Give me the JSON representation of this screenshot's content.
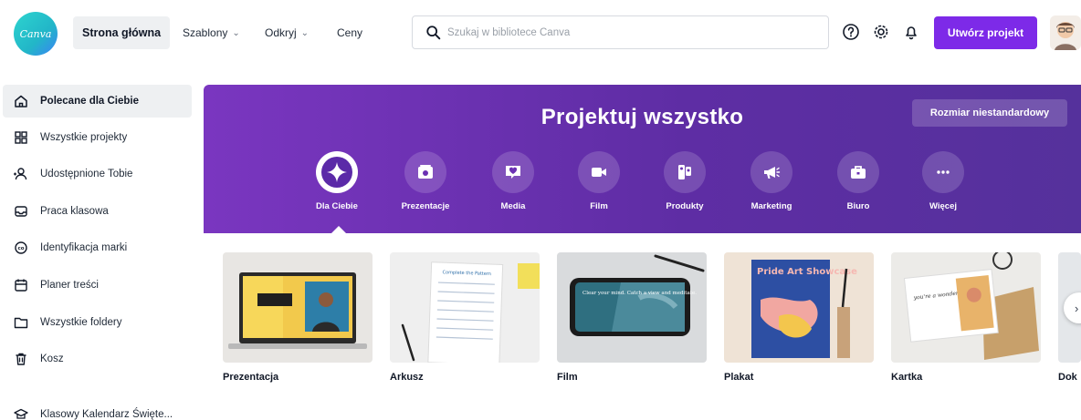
{
  "header": {
    "logo_text": "Canva",
    "nav": {
      "home": "Strona główna",
      "templates": "Szablony",
      "discover": "Odkryj",
      "prices": "Ceny"
    },
    "search_placeholder": "Szukaj w bibliotece Canva",
    "create_button": "Utwórz projekt",
    "icons": [
      "help-icon",
      "settings-icon",
      "bell-icon"
    ]
  },
  "sidebar": {
    "items": [
      {
        "label": "Polecane dla Ciebie",
        "icon": "home-icon",
        "active": true
      },
      {
        "label": "Wszystkie projekty",
        "icon": "grid-icon"
      },
      {
        "label": "Udostępnione Tobie",
        "icon": "shared-users-icon"
      },
      {
        "label": "Praca klasowa",
        "icon": "inbox-icon"
      },
      {
        "label": "Identyfikacja marki",
        "icon": "brand-icon"
      },
      {
        "label": "Planer treści",
        "icon": "calendar-icon"
      },
      {
        "label": "Wszystkie foldery",
        "icon": "folder-icon"
      },
      {
        "label": "Kosz",
        "icon": "trash-icon"
      },
      {
        "label": "Klasowy Kalendarz Święte...",
        "icon": "classroom-icon"
      }
    ]
  },
  "banner": {
    "title": "Projektuj wszystko",
    "custom_size": "Rozmiar niestandardowy",
    "categories": [
      {
        "label": "Dla Ciebie",
        "icon": "sparkle-icon",
        "active": true
      },
      {
        "label": "Prezentacje",
        "icon": "presentation-icon"
      },
      {
        "label": "Media",
        "icon": "heart-chat-icon"
      },
      {
        "label": "Film",
        "icon": "video-camera-icon"
      },
      {
        "label": "Produkty",
        "icon": "products-icon"
      },
      {
        "label": "Marketing",
        "icon": "megaphone-icon"
      },
      {
        "label": "Biuro",
        "icon": "briefcase-icon"
      },
      {
        "label": "Więcej",
        "icon": "more-dots-icon"
      }
    ]
  },
  "cards": [
    {
      "label": "Prezentacja"
    },
    {
      "label": "Arkusz",
      "sheet_title": "Complete the Pattern"
    },
    {
      "label": "Film",
      "screen_text": "Clear your mind. Catch a view and meditate."
    },
    {
      "label": "Plakat",
      "poster_text": "Pride Art Showcase"
    },
    {
      "label": "Kartka",
      "card_text": "you're a wonderful mom!"
    },
    {
      "label": "Dok"
    }
  ],
  "colors": {
    "accent": "#7d2ae8",
    "banner_start": "#7a36c0",
    "banner_end": "#55319c",
    "active_bg": "#eef0f2"
  }
}
